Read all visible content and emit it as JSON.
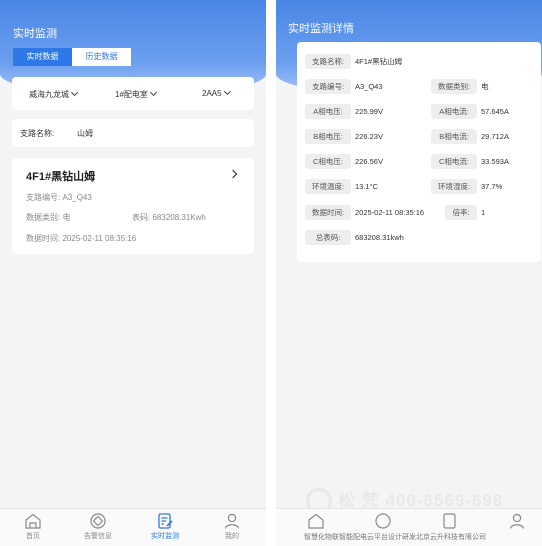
{
  "left": {
    "header_title": "实时监测",
    "tabs": [
      "实时数据",
      "历史数据"
    ],
    "filters": [
      "威海九龙城",
      "1#配电室",
      "2AA5"
    ],
    "branch_name_label": "支路名称:",
    "branch_name_value": "山姆",
    "circuit": {
      "title": "4F1#黑钻山姆",
      "code_label": "支路编号:",
      "code_value": "A3_Q43",
      "type_label": "数据类别:",
      "type_value": "电",
      "meter_label": "表码:",
      "meter_value": "683208.31Kwh",
      "time_label": "数据时间:",
      "time_value": "2025-02-11 08:35:16"
    }
  },
  "nav": [
    {
      "label": "首页",
      "icon": "home-icon"
    },
    {
      "label": "告警信息",
      "icon": "alarm-icon"
    },
    {
      "label": "实时监测",
      "icon": "monitor-icon"
    },
    {
      "label": "我的",
      "icon": "user-icon"
    }
  ],
  "right": {
    "header_title": "实时监测详情",
    "rows": [
      {
        "l1": "支路名称:",
        "v1": "4F1#黑钻山姆"
      },
      {
        "l1": "支路编号:",
        "v1": "A3_Q43",
        "l2": "数据类别:",
        "v2": "电"
      },
      {
        "l1": "A相电压:",
        "v1": "225.99V",
        "l2": "A相电流:",
        "v2": "57.645A"
      },
      {
        "l1": "B相电压:",
        "v1": "226.23V",
        "l2": "B相电流:",
        "v2": "29.712A"
      },
      {
        "l1": "C相电压:",
        "v1": "226.56V",
        "l2": "C相电流:",
        "v2": "33.593A"
      },
      {
        "l1": "环境温度:",
        "v1": "13.1°C",
        "l2": "环境湿度:",
        "v2": "37.7%"
      },
      {
        "l1": "数据时间:",
        "v1": "2025-02-11 08:35:16",
        "l2": "倍率:",
        "v2": "1"
      },
      {
        "l1": "总表码:",
        "v1": "683208.31kwh"
      }
    ],
    "watermark": "松 梵 400-6569-698",
    "footer_note": "智慧化物联智能配电云平台设计研发北京云升科技有限公司"
  },
  "colors": {
    "accent": "#2e78e8",
    "header_top": "#4a86e6"
  }
}
